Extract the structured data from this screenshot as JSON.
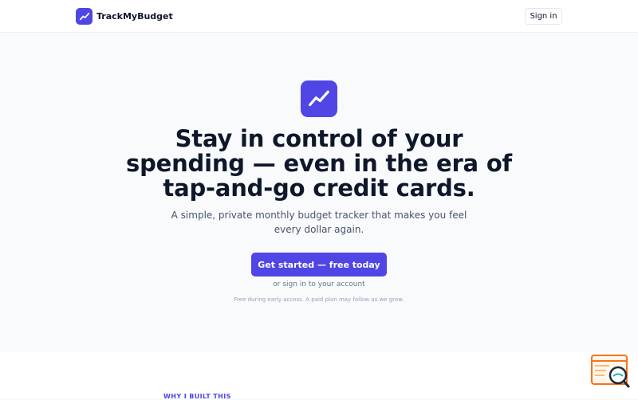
{
  "header": {
    "brand_name": "TrackMyBudget",
    "signin_label": "Sign in"
  },
  "hero": {
    "headline": "Stay in control of your spending — even in the era of tap-and-go credit cards.",
    "subheadline": "A simple, private monthly budget tracker that makes you feel every dollar again.",
    "cta_label": "Get started — free today",
    "signin_link": "or sign in to your account",
    "note": "Free during early access. A paid plan may follow as we grow."
  },
  "section": {
    "label": "WHY I BUILT THIS"
  },
  "icons": {
    "logo": "trending-up-icon",
    "widget": "search-window-icon"
  },
  "colors": {
    "accent": "#4f46e5",
    "text": "#0f172a",
    "muted": "#475569",
    "background": "#f8fafc",
    "widget": "#f97316"
  }
}
